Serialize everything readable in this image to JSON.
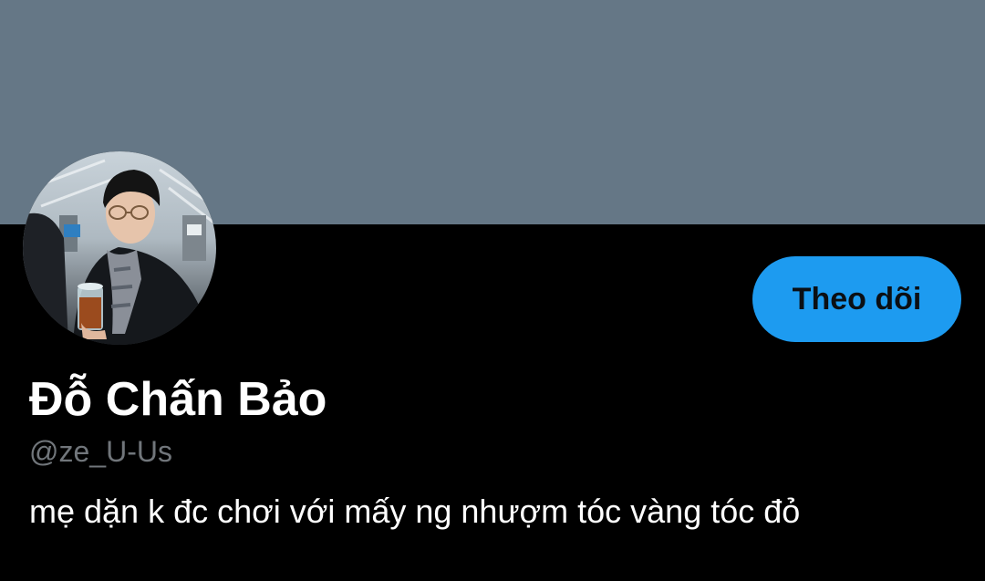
{
  "profile": {
    "banner_color": "#657786",
    "avatar_icon": "profile-photo",
    "display_name": "Đỗ Chấn Bảo",
    "handle": "@ze_U-Us",
    "bio": "mẹ dặn k đc chơi với mấy ng nhượm tóc vàng tóc đỏ"
  },
  "actions": {
    "follow_label": "Theo dõi",
    "follow_color": "#1d9bf0"
  }
}
